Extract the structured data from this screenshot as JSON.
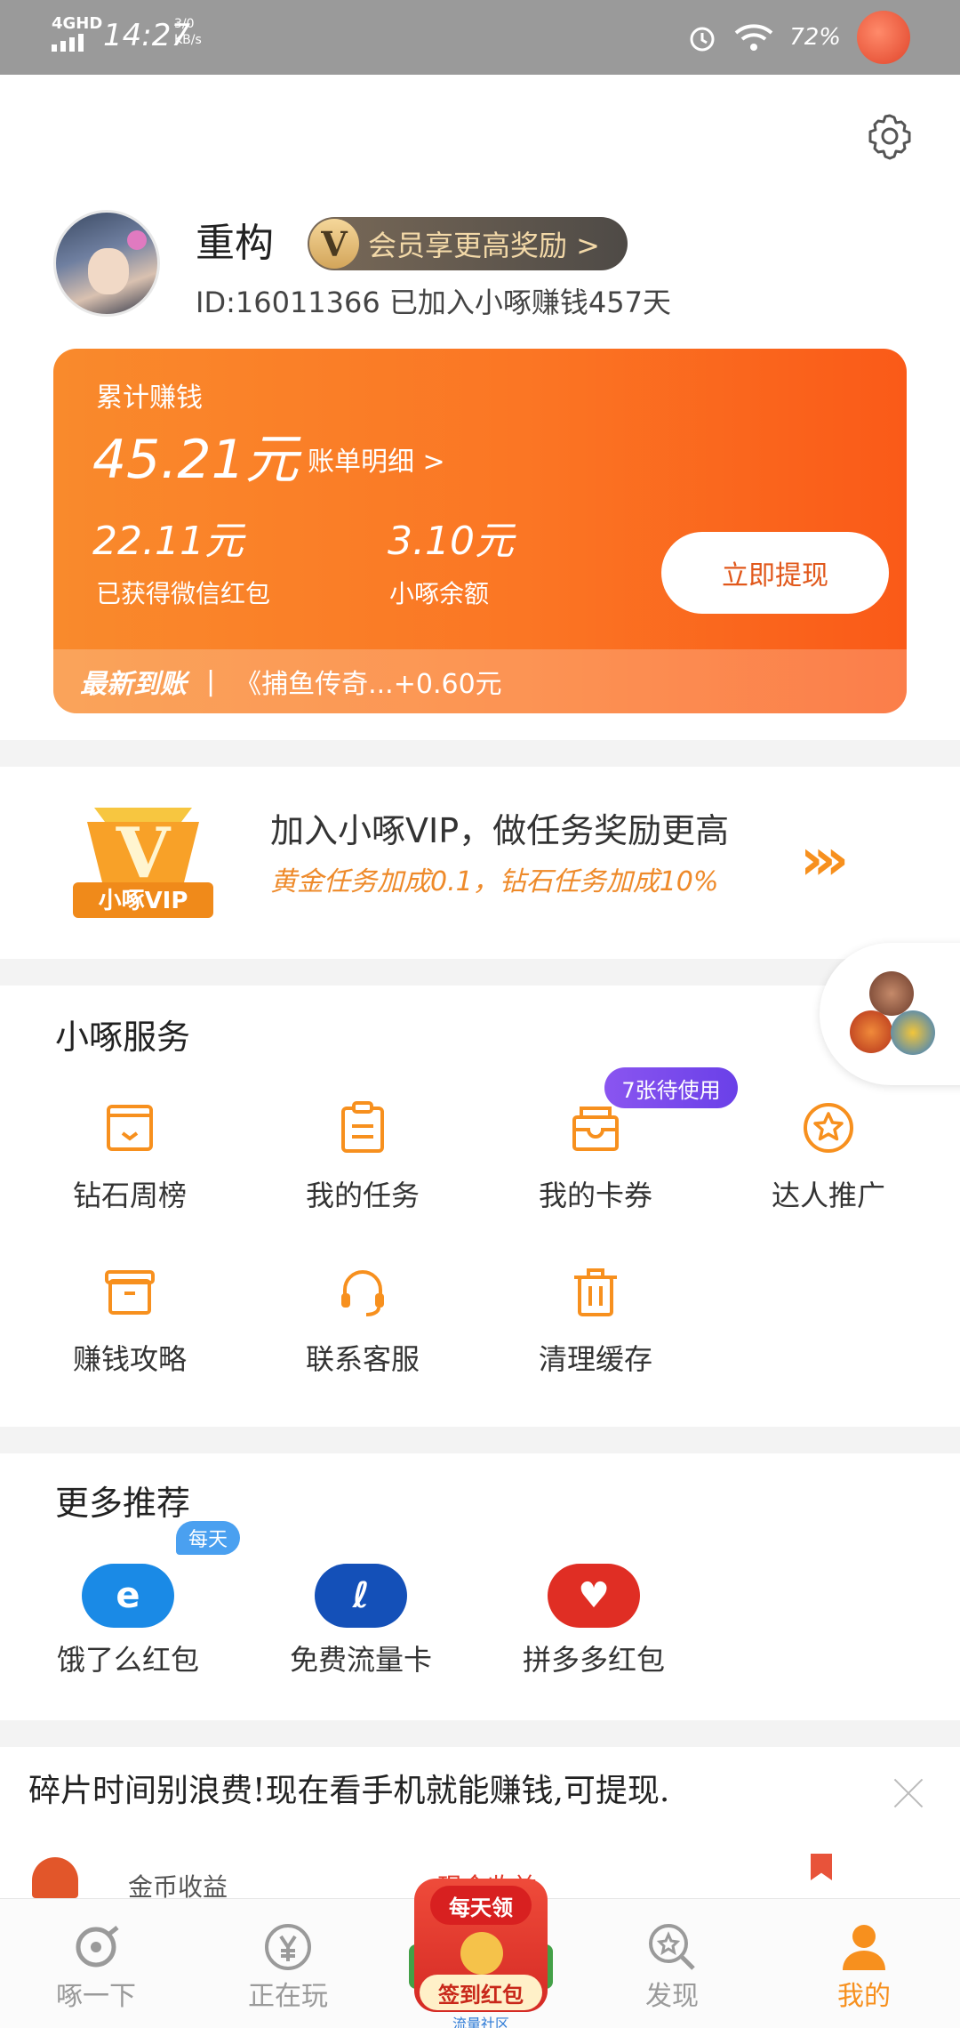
{
  "status_bar": {
    "network": "4GHD",
    "time": "14:27",
    "speed": "3/0 KB/s",
    "battery": "72%"
  },
  "profile": {
    "username": "重构",
    "vip_badge": "V",
    "vip_pill_label": "会员享更高奖励 >",
    "id_line": "ID:16011366 已加入小啄赚钱457天"
  },
  "earnings": {
    "label": "累计赚钱",
    "total": "45.21元",
    "detail_link": "账单明细 >",
    "wechat_value": "22.11元",
    "wechat_label": "已获得微信红包",
    "balance_value": "3.10元",
    "balance_label": "小啄余额",
    "withdraw_button": "立即提现",
    "ticker_tag": "最新到账",
    "ticker_sep": "|",
    "ticker_text": "《捕鱼传奇...+0.60元"
  },
  "vip_banner": {
    "badge_text": "小啄VIP",
    "badge_letter": "V",
    "title": "加入小啄VIP，做任务奖励更高",
    "subtitle": "黄金任务加成0.1，钻石任务加成10%",
    "arrows": "›››"
  },
  "services": {
    "title": "小啄服务",
    "items": [
      {
        "label": "钻石周榜",
        "icon": "envelope-icon"
      },
      {
        "label": "我的任务",
        "icon": "clipboard-icon"
      },
      {
        "label": "我的卡券",
        "icon": "ticket-box-icon"
      },
      {
        "label": "达人推广",
        "icon": "star-badge-icon"
      },
      {
        "label": "赚钱攻略",
        "icon": "box-icon"
      },
      {
        "label": "联系客服",
        "icon": "headset-icon"
      },
      {
        "label": "清理缓存",
        "icon": "trash-icon"
      }
    ],
    "coupon_badge": "7张待使用"
  },
  "more": {
    "title": "更多推荐",
    "daily_badge": "每天",
    "apps": [
      {
        "label": "饿了么红包",
        "icon": "eleme-icon",
        "color": "#1a8ae6"
      },
      {
        "label": "免费流量卡",
        "icon": "telecom-icon",
        "color": "#1450b8"
      },
      {
        "label": "拼多多红包",
        "icon": "pinduoduo-icon",
        "color": "#e02e24"
      }
    ]
  },
  "promo": {
    "text": "碎片时间别浪费!现在看手机就能赚钱,可提现.",
    "sub1": "金币收益",
    "sub2": "现金收益"
  },
  "nav": {
    "items": [
      {
        "label": "啄一下",
        "icon": "peck-icon"
      },
      {
        "label": "正在玩",
        "icon": "yuan-icon"
      },
      {
        "label": "发现",
        "icon": "discover-icon"
      },
      {
        "label": "我的",
        "icon": "profile-icon"
      }
    ],
    "redpack_top": "每天领",
    "redpack_button": "签到红包",
    "redpack_caption": "流量社区"
  },
  "colors": {
    "accent": "#f7901e",
    "card_orange": "#fb7624",
    "coupon_purple": "#7a4af0",
    "nav_inactive": "#9a9a9a"
  }
}
